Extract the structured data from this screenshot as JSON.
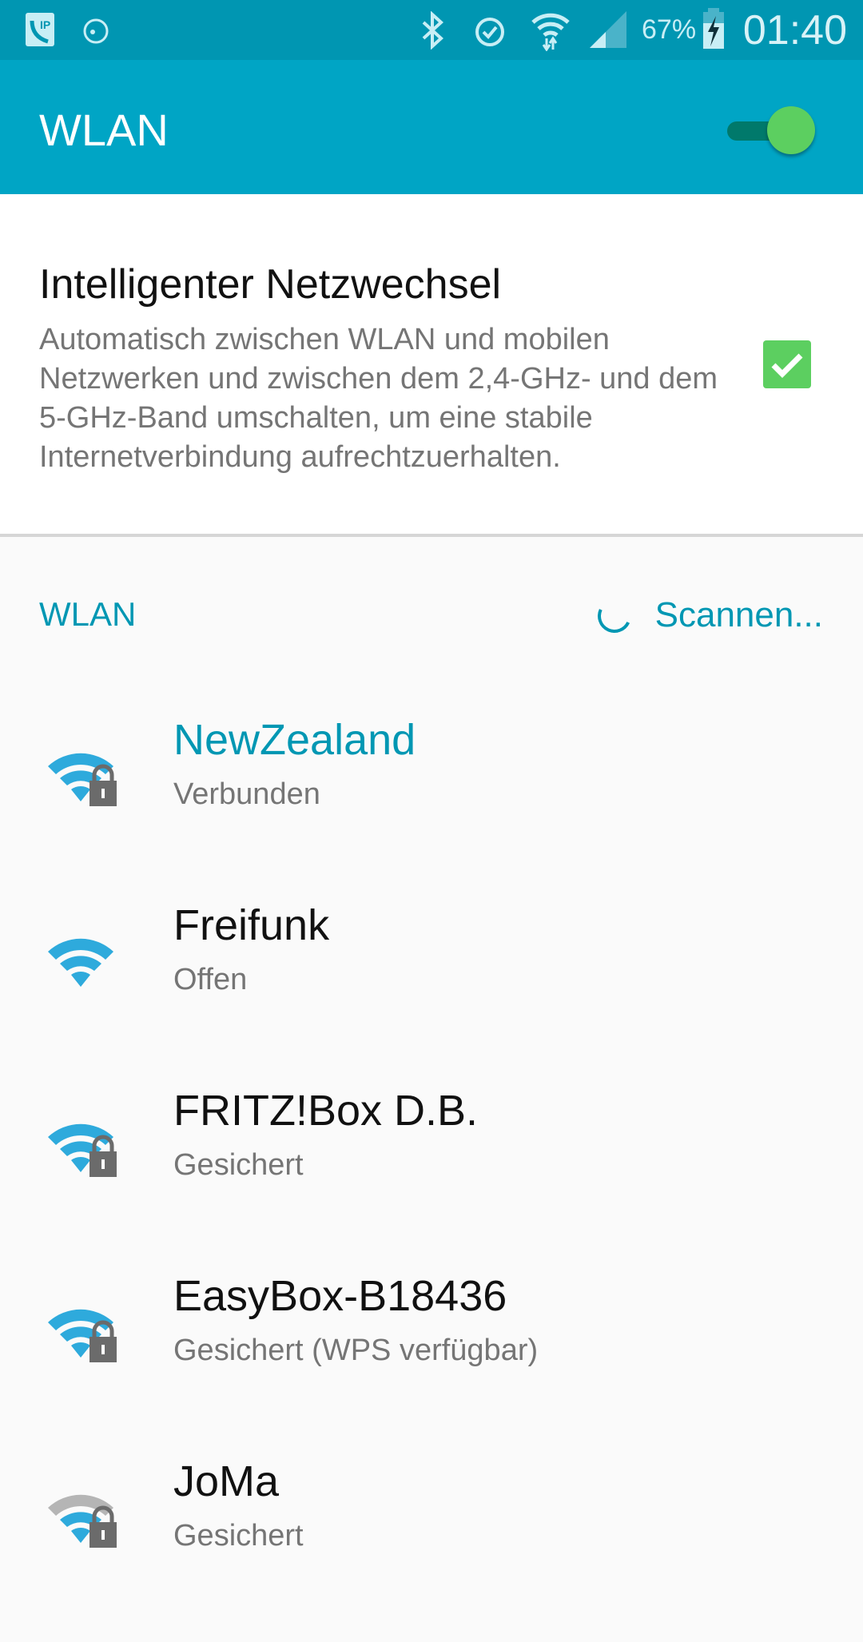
{
  "status_bar": {
    "battery": "67%",
    "time": "01:40",
    "icons": [
      "voip-call-icon",
      "alarm-icon",
      "bluetooth-icon",
      "alarm-check-icon",
      "wifi-data-icon",
      "signal-icon",
      "battery-charging-icon"
    ]
  },
  "app_bar": {
    "title": "WLAN",
    "toggle_on": true
  },
  "smart_switch": {
    "title": "Intelligenter Netzwechsel",
    "description": "Automatisch zwischen WLAN und mobilen Netzwerken und zwischen dem 2,4-GHz- und dem 5-GHz-Band umschalten, um eine stabile Internetverbindung aufrechtzuerhalten.",
    "checked": true
  },
  "section": {
    "title": "WLAN",
    "scan_label": "Scannen..."
  },
  "networks": [
    {
      "name": "NewZealand",
      "status": "Verbunden",
      "secured": true,
      "signal": 4
    },
    {
      "name": "Freifunk",
      "status": "Offen",
      "secured": false,
      "signal": 4
    },
    {
      "name": "FRITZ!Box D.B.",
      "status": "Gesichert",
      "secured": true,
      "signal": 4
    },
    {
      "name": "EasyBox-B18436",
      "status": "Gesichert (WPS verfügbar)",
      "secured": true,
      "signal": 4
    },
    {
      "name": "JoMa",
      "status": "Gesichert",
      "secured": true,
      "signal": 3
    }
  ],
  "colors": {
    "status_bar": "#0096b2",
    "app_bar": "#00a5c5",
    "accent": "#0097b3",
    "toggle_thumb": "#5ccf60",
    "wifi_icon": "#2eaadc"
  }
}
